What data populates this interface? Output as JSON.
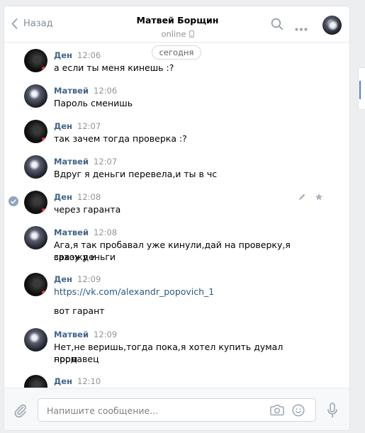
{
  "header": {
    "back_label": "Назад",
    "peer_name": "Матвей Борщин",
    "peer_status": "online"
  },
  "date_divider": "сегодня",
  "messages": [
    {
      "author": "Ден",
      "time": "12:06",
      "lines": [
        "а если ты меня кинешь :?"
      ],
      "avatar": "dark"
    },
    {
      "author": "Матвей",
      "time": "12:06",
      "lines": [
        "Пароль сменишь"
      ],
      "avatar": "light"
    },
    {
      "author": "Ден",
      "time": "12:07",
      "lines": [
        "так зачем тогда проверка :?"
      ],
      "avatar": "dark"
    },
    {
      "author": "Матвей",
      "time": "12:07",
      "lines": [
        "Вдруг я деньги перевела,и ты в чс"
      ],
      "avatar": "light"
    },
    {
      "author": "Ден",
      "time": "12:08",
      "lines": [
        "через гаранта"
      ],
      "avatar": "dark",
      "selected": true
    },
    {
      "author": "Матвей",
      "time": "12:08",
      "lines": [
        "Ага,я так пробавал уже кинули,дай на проверку,я захожу и",
        "сразу деньги"
      ],
      "avatar": "light"
    },
    {
      "author": "Ден",
      "time": "12:09",
      "link": "https://vk.com/alexandr_popovich_1",
      "lines": [
        "вот гарант"
      ],
      "avatar": "dark"
    },
    {
      "author": "Матвей",
      "time": "12:09",
      "lines": [
        "Нет,не веришь,тогда пока,я хотел купить думал норм",
        "продавец"
      ],
      "avatar": "light"
    },
    {
      "author": "Ден",
      "time": "12:10",
      "lines": [],
      "avatar": "dark"
    }
  ],
  "composer": {
    "placeholder": "Напишите сообщение..."
  },
  "icons": [
    "chevron-left-icon",
    "phone-icon",
    "search-icon",
    "more-icon",
    "check-icon",
    "pencil-icon",
    "star-icon",
    "paperclip-icon",
    "camera-icon",
    "smile-icon",
    "microphone-icon"
  ],
  "colors": {
    "author": "#42648b",
    "link": "#2a5885",
    "time": "#939393",
    "accent": "#5181b8"
  }
}
